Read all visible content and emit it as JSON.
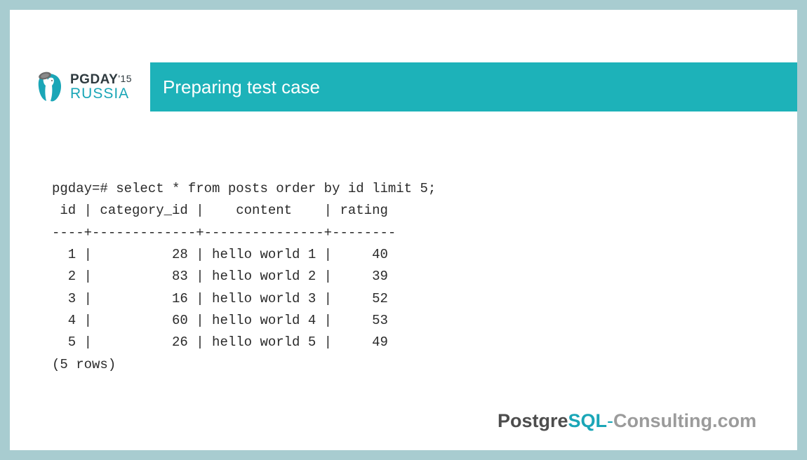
{
  "logo": {
    "line1": "PGDAY",
    "year": "'15",
    "line2": "RUSSIA"
  },
  "title": "Preparing test case",
  "sql": {
    "query": "pgday=# select * from posts order by id limit 5;",
    "header": " id | category_id |    content    | rating",
    "separator": "----+-------------+---------------+--------",
    "rows": [
      "  1 |          28 | hello world 1 |     40",
      "  2 |          83 | hello world 2 |     39",
      "  3 |          16 | hello world 3 |     52",
      "  4 |          60 | hello world 4 |     53",
      "  5 |          26 | hello world 5 |     49"
    ],
    "footer": "(5 rows)"
  },
  "branding": {
    "p1": "Postgre",
    "p2": "SQL",
    "dash": "-",
    "p3": "Consulting",
    "p4": ".com"
  }
}
